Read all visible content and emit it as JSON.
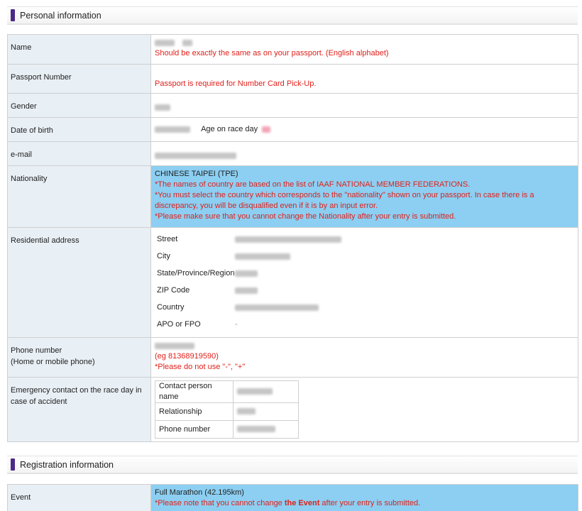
{
  "personal": {
    "heading": "Personal information",
    "name": {
      "label": "Name",
      "note": "Should be exactly the same as on your passport. (English alphabet)"
    },
    "passport": {
      "label": "Passport Number",
      "note": "Passport is required for Number Card Pick-Up."
    },
    "gender": {
      "label": "Gender"
    },
    "dob": {
      "label": "Date of birth",
      "age_label": "Age on race day"
    },
    "email": {
      "label": "e-mail"
    },
    "nationality": {
      "label": "Nationality",
      "value": "CHINESE TAIPEI (TPE)",
      "notes": [
        "*The names of country are based on the list of IAAF NATIONAL MEMBER FEDERATIONS.",
        "*You must select the country which corresponds to the \"nationality\" shown on your passport. In case there is a discrepancy, you will be disqualified even if it is by an input error.",
        "*Please make sure that you cannot change the Nationality after your entry is submitted."
      ]
    },
    "address": {
      "label": "Residential address",
      "street": "Street",
      "city": "City",
      "state": "State/Province/Region",
      "zip": "ZIP Code",
      "country": "Country",
      "apo": "APO or FPO",
      "apo_value": "-"
    },
    "phone": {
      "label_line1": "Phone number",
      "label_line2": "(Home or mobile phone)",
      "example": "(eg 81368919590)",
      "note": "*Please do not use \"-\", \"+\""
    },
    "emergency": {
      "label": "Emergency contact on the race day in case of accident",
      "contact_person": "Contact person name",
      "relationship": "Relationship",
      "phone": "Phone number"
    }
  },
  "registration": {
    "heading": "Registration information",
    "event": {
      "label": "Event",
      "value": "Full Marathon (42.195km)",
      "note_prefix": "*Please note that you cannot change ",
      "note_bold": "the Event",
      "note_suffix": " after your entry is submitted."
    }
  },
  "colors": {
    "accent_bar": "#4b2a88",
    "label_bg": "#e8eff5",
    "highlight_bg": "#8ccff2",
    "warning_text": "#e0201a"
  }
}
